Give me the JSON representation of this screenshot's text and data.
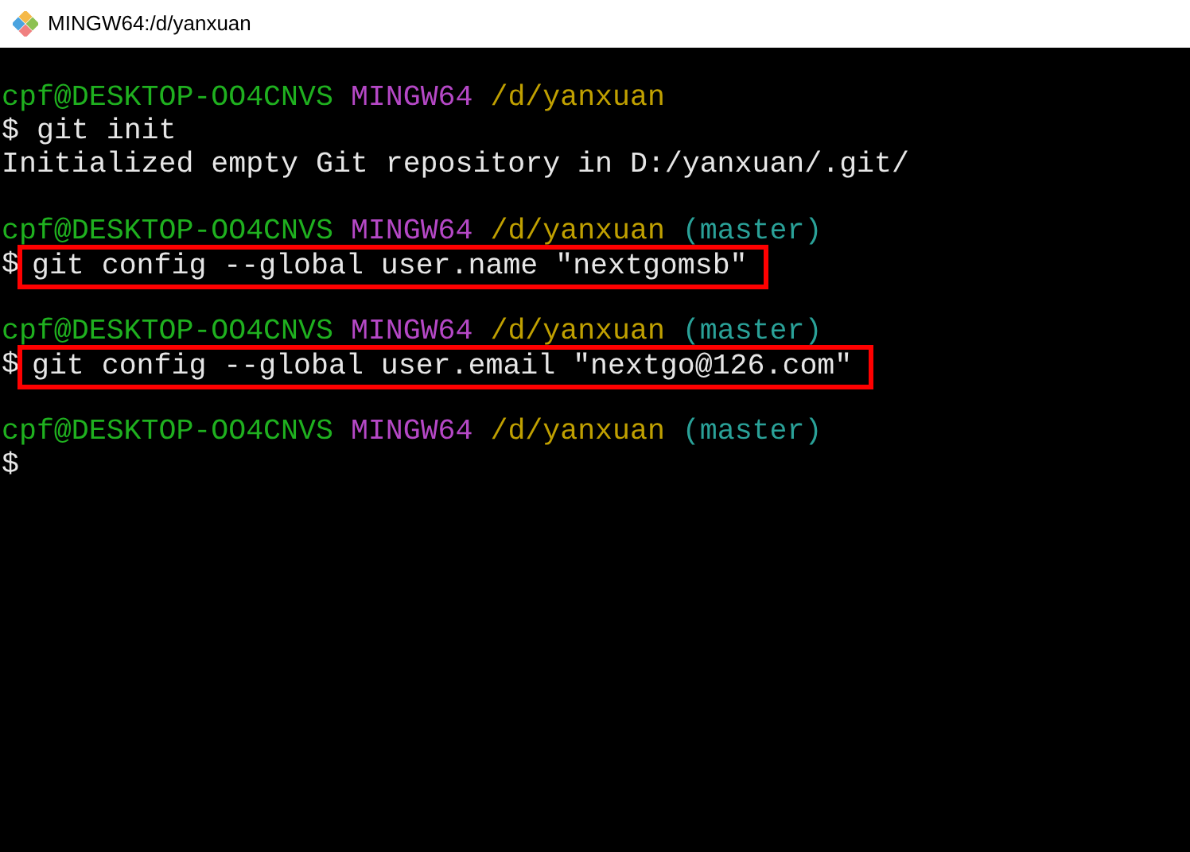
{
  "window": {
    "title": "MINGW64:/d/yanxuan"
  },
  "terminal": {
    "blocks": [
      {
        "prompt": {
          "user_host": "cpf@DESKTOP-OO4CNVS",
          "system": "MINGW64",
          "path": "/d/yanxuan"
        },
        "symbol": "$",
        "command": "git init",
        "highlighted": false,
        "output": [
          "Initialized empty Git repository in D:/yanxuan/.git/"
        ]
      },
      {
        "prompt": {
          "user_host": "cpf@DESKTOP-OO4CNVS",
          "system": "MINGW64",
          "path": "/d/yanxuan",
          "branch": "(master)"
        },
        "symbol": "$",
        "command": "git config --global user.name \"nextgomsb\"",
        "highlighted": true
      },
      {
        "prompt": {
          "user_host": "cpf@DESKTOP-OO4CNVS",
          "system": "MINGW64",
          "path": "/d/yanxuan",
          "branch": "(master)"
        },
        "symbol": "$",
        "command": "git config --global user.email \"nextgo@126.com\"",
        "highlighted": true
      },
      {
        "prompt": {
          "user_host": "cpf@DESKTOP-OO4CNVS",
          "system": "MINGW64",
          "path": "/d/yanxuan",
          "branch": "(master)"
        },
        "symbol": "$"
      }
    ]
  }
}
